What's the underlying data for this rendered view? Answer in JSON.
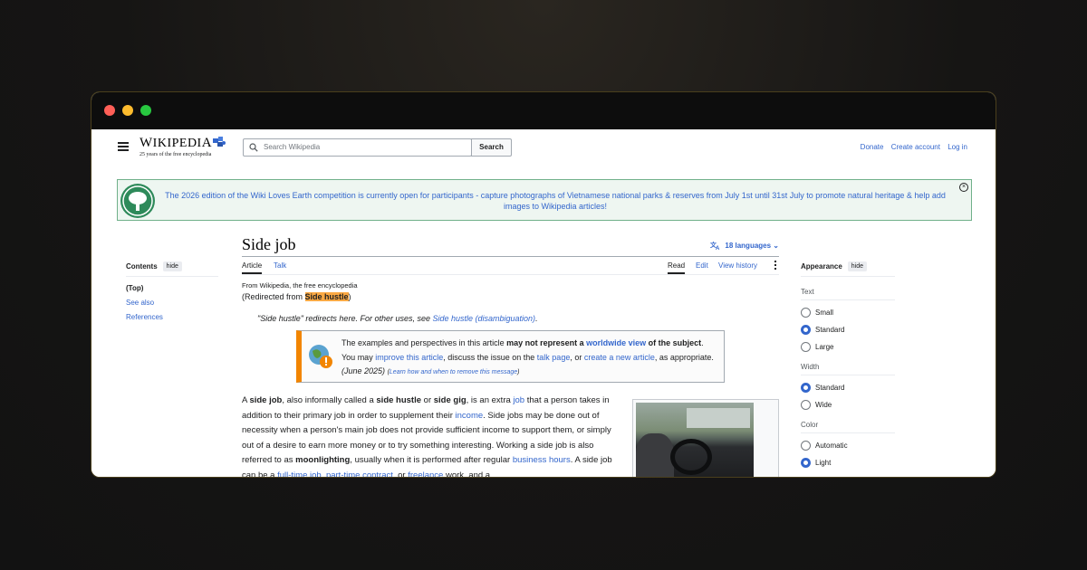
{
  "header": {
    "logo_word": "Wikipedia",
    "logo_tagline": "25 years of the free encyclopedia",
    "search_placeholder": "Search Wikipedia",
    "search_button": "Search",
    "links": [
      "Donate",
      "Create account",
      "Log in"
    ]
  },
  "banner": {
    "text": "The 2026 edition of the Wiki Loves Earth competition is currently open for participants - capture photographs of Vietnamese national parks & reserves from July 1st until 31st July to promote natural heritage & help add images to Wikipedia articles!"
  },
  "toc": {
    "title": "Contents",
    "hide_label": "hide",
    "items": [
      "(Top)",
      "See also",
      "References"
    ]
  },
  "article": {
    "title": "Side job",
    "languages": "18 languages",
    "tabs_left": [
      "Article",
      "Talk"
    ],
    "tabs_right": [
      "Read",
      "Edit",
      "View history"
    ],
    "from": "From Wikipedia, the free encyclopedia",
    "redirected_prefix": "(Redirected from ",
    "redirected_term": "Side hustle",
    "redirected_suffix": ")",
    "hatnote_prefix": "\"Side hustle\" redirects here. For other uses, see ",
    "hatnote_link": "Side hustle (disambiguation)",
    "hatnote_suffix": ".",
    "ambox": {
      "p1": "The examples and perspectives in this article ",
      "b1": "may not represent a ",
      "l1": "worldwide view",
      "b2": " of the subject",
      "p2": ". You may ",
      "l2": "improve this article",
      "p3": ", discuss the issue on the ",
      "l3": "talk page",
      "p4": ", or ",
      "l4": "create a new article",
      "p5": ", as appropriate. ",
      "date": "(June 2025)",
      "small": "Learn how and when to remove this message"
    },
    "body": {
      "t1": "A ",
      "b1": "side job",
      "t2": ", also informally called a ",
      "b2": "side hustle",
      "t3": " or ",
      "b3": "side gig",
      "t4": ", is an extra ",
      "l1": "job",
      "t5": " that a person takes in addition to their primary job in order to supplement their ",
      "l2": "income",
      "t6": ". Side jobs may be done out of necessity when a person's main job does not provide sufficient income to support them, or simply out of a desire to earn more money or to try something interesting. Working a side job is also referred to as ",
      "b4": "moonlighting",
      "t7": ", usually when it is performed after regular ",
      "l3": "business hours",
      "t8": ". A side job can be a ",
      "l4": "full-time job",
      "t9": ", ",
      "l5": "part-time contract",
      "t10": ", or ",
      "l6": "freelance",
      "t11": " work, and a"
    }
  },
  "appearance": {
    "title": "Appearance",
    "hide_label": "hide",
    "text_label": "Text",
    "text_options": [
      "Small",
      "Standard",
      "Large"
    ],
    "text_selected": "Standard",
    "width_label": "Width",
    "width_options": [
      "Standard",
      "Wide"
    ],
    "width_selected": "Standard",
    "color_label": "Color",
    "color_options": [
      "Automatic",
      "Light"
    ],
    "color_selected": "Light"
  },
  "colors": {
    "link": "#3366cc",
    "banner_border": "#70b08a",
    "ambox_bar": "#f28500",
    "highlight": "#fba944"
  }
}
